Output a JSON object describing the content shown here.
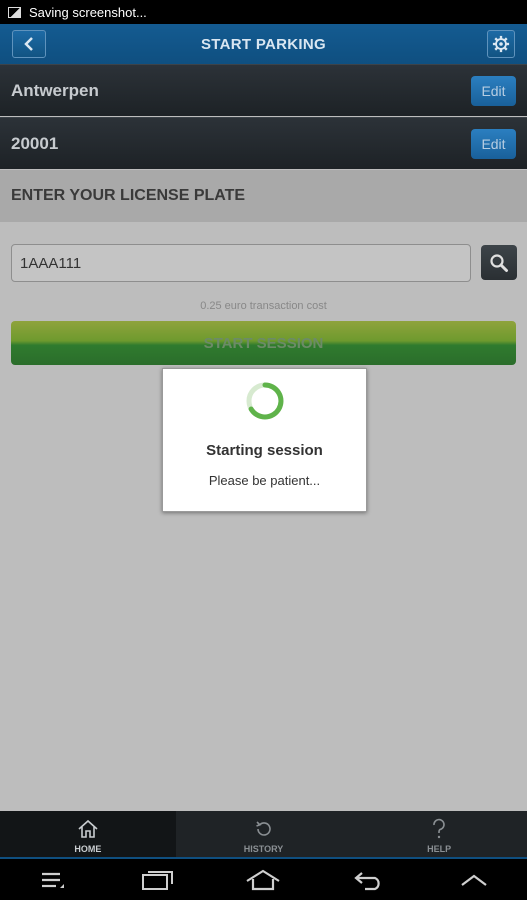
{
  "status_bar": {
    "notification": "Saving screenshot..."
  },
  "header": {
    "title": "START PARKING"
  },
  "location": {
    "city": "Antwerpen",
    "zone": "20001",
    "edit_label": "Edit"
  },
  "license": {
    "section_title": "ENTER YOUR LICENSE PLATE",
    "plate_value": "1AAA111",
    "cost_note": "0.25 euro transaction cost",
    "start_label": "START SESSION"
  },
  "dialog": {
    "title": "Starting session",
    "message": "Please be patient..."
  },
  "tabs": [
    {
      "label": "HOME",
      "icon": "home-icon",
      "active": true
    },
    {
      "label": "HISTORY",
      "icon": "history-icon",
      "active": false
    },
    {
      "label": "HELP",
      "icon": "help-icon",
      "active": false
    }
  ],
  "colors": {
    "header": "#145b91",
    "accent_green": "#6e9a2e",
    "edit_blue": "#2b7fc0"
  }
}
